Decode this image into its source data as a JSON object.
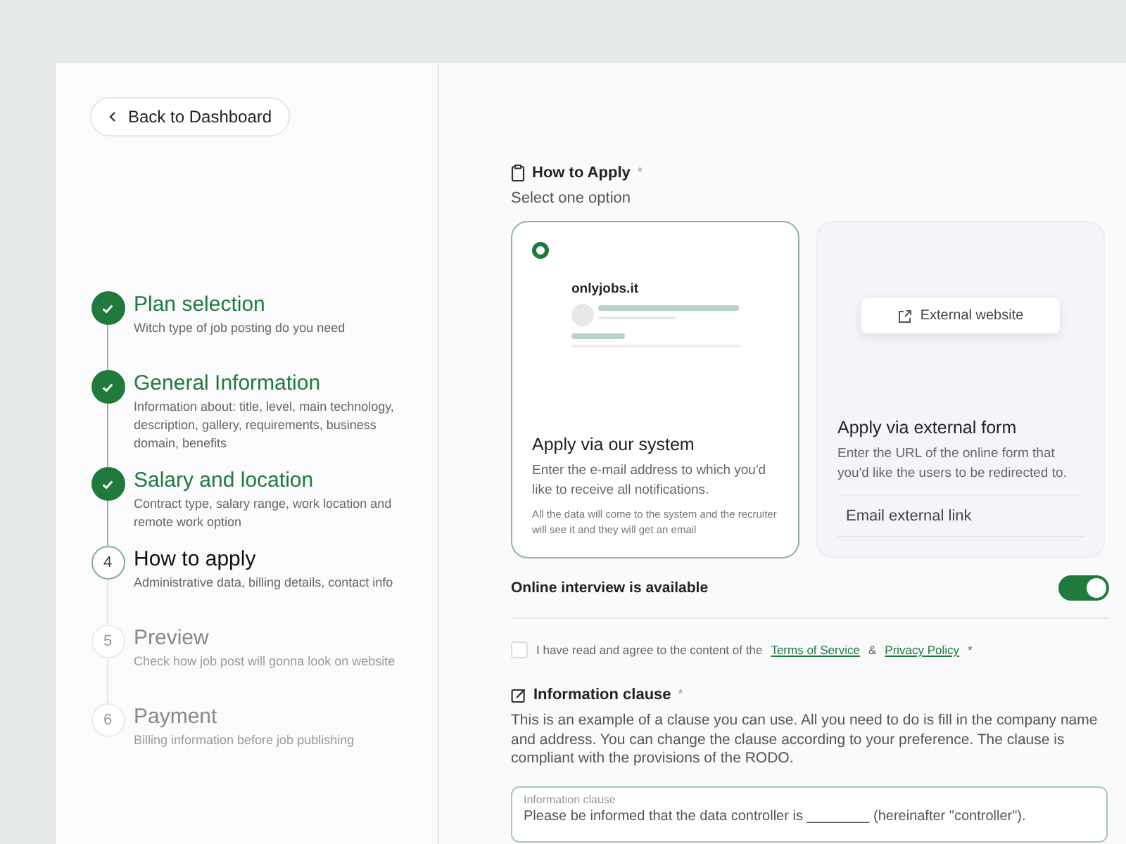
{
  "back_button": {
    "label": "Back to Dashboard"
  },
  "steps": [
    {
      "title": "Plan selection",
      "description": "Witch type of job posting do you need",
      "completed": true
    },
    {
      "title": "General Information",
      "description": "Information about: title, level, main technology, description, gallery, requirements, business domain, benefits",
      "completed": true
    },
    {
      "title": "Salary and location",
      "description": "Contract type, salary range, work location and remote work option",
      "completed": true
    },
    {
      "number": "4",
      "title": "How to apply",
      "description": "Administrative data, billing details, contact info",
      "completed": false,
      "current": true
    },
    {
      "number": "5",
      "title": "Preview",
      "description": "Check how job post will gonna look on website",
      "completed": false,
      "current": false
    },
    {
      "number": "6",
      "title": "Payment",
      "description": "Billing information before job publishing",
      "completed": false,
      "current": false
    }
  ],
  "how_to_apply": {
    "title": "How to Apply",
    "required_mark": "*",
    "subtitle": "Select one option"
  },
  "cards": [
    {
      "kind": "system",
      "selected": true,
      "preview_site": "onlyjobs.it",
      "title": "Apply via our system",
      "description": "Enter the e-mail address to which you'd like to receive all notifications.",
      "note": "All the data will come to the system and the recruiter will see it and they will get an email"
    },
    {
      "kind": "external",
      "selected": false,
      "preview_button": "External website",
      "title": "Apply via external form",
      "description": "Enter the URL of the online form that you'd like the users to be redirected to.",
      "placeholder": "Email external link"
    }
  ],
  "online_interview": {
    "label": "Online interview is available",
    "on": true
  },
  "terms": {
    "checked": false,
    "text_before": "I have read and agree to the content of the",
    "link_1": "Terms of Service",
    "separator": "&",
    "link_2": "Privacy Policy",
    "required_mark": "*"
  },
  "information_clause": {
    "title": "Information clause",
    "required_mark": "*",
    "description": "This is an example of a clause you can use. All you need to do is fill in the company name and address. You can change the clause according to your preference. The clause is compliant with the provisions of the RODO.",
    "field_label": "Information clause",
    "value": "Please be informed that the data controller is ________ (hereinafter \"controller\")."
  }
}
